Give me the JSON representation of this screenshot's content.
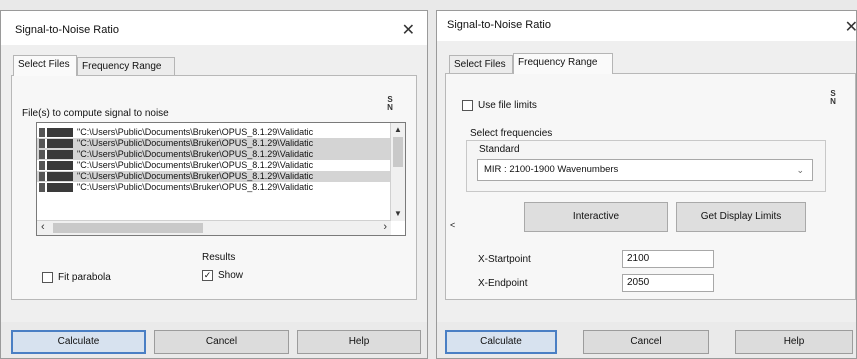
{
  "left_dialog": {
    "title": "Signal-to-Noise Ratio",
    "close_glyph": "✕",
    "tabs": [
      "Select Files",
      "Frequency Range"
    ],
    "active_tab": "Select Files",
    "files_label": "File(s) to compute signal to noise",
    "sn_icon": {
      "top": "S",
      "bottom": "N"
    },
    "files": [
      "\"C:\\Users\\Public\\Documents\\Bruker\\OPUS_8.1.29\\Validatic",
      "\"C:\\Users\\Public\\Documents\\Bruker\\OPUS_8.1.29\\Validatic",
      "\"C:\\Users\\Public\\Documents\\Bruker\\OPUS_8.1.29\\Validatic",
      "\"C:\\Users\\Public\\Documents\\Bruker\\OPUS_8.1.29\\Validatic",
      "\"C:\\Users\\Public\\Documents\\Bruker\\OPUS_8.1.29\\Validatic",
      "\"C:\\Users\\Public\\Documents\\Bruker\\OPUS_8.1.29\\Validatic"
    ],
    "scroll_arrows": {
      "up": "▲",
      "down": "▼",
      "left": "‹",
      "right": "›"
    },
    "fit_parabola_label": "Fit parabola",
    "fit_parabola_checked": false,
    "results_label": "Results",
    "show_label": "Show",
    "show_checked": true,
    "check_glyph": "✓",
    "buttons": {
      "calculate": "Calculate",
      "cancel": "Cancel",
      "help": "Help"
    }
  },
  "right_dialog": {
    "title": "Signal-to-Noise Ratio",
    "close_glyph": "✕",
    "tabs": [
      "Select Files",
      "Frequency Range"
    ],
    "active_tab": "Frequency Range",
    "sn_icon": {
      "top": "S",
      "bottom": "N"
    },
    "use_file_limits_label": "Use file limits",
    "use_file_limits_checked": false,
    "select_frequencies_label": "Select frequencies",
    "standard_label": "Standard",
    "standard_value": "MIR : 2100-1900 Wavenumbers",
    "dropdown_glyph": "⌄",
    "side_arrow": "<",
    "interactive_button": "Interactive",
    "get_display_limits_button": "Get Display Limits",
    "x_startpoint_label": "X-Startpoint",
    "x_startpoint_value": "2100",
    "x_endpoint_label": "X-Endpoint",
    "x_endpoint_value": "2050",
    "buttons": {
      "calculate": "Calculate",
      "cancel": "Cancel",
      "help": "Help"
    }
  }
}
